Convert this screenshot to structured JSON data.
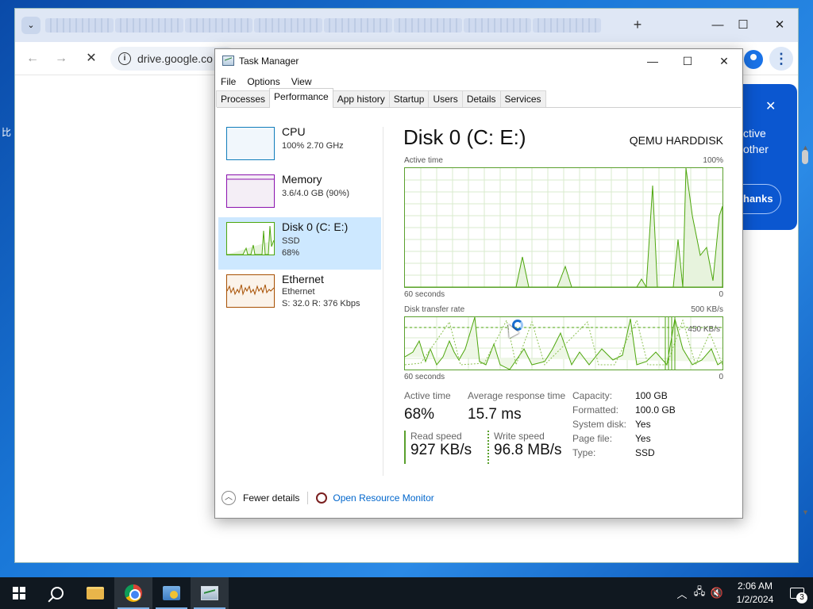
{
  "desktop": {
    "left_glyph": "比"
  },
  "chrome": {
    "url": "drive.google.co",
    "promo": {
      "text_line1": "ctive",
      "text_line2": "other",
      "button": "hanks"
    }
  },
  "task_manager": {
    "title": "Task Manager",
    "menu": [
      "File",
      "Options",
      "View"
    ],
    "tabs": [
      "Processes",
      "Performance",
      "App history",
      "Startup",
      "Users",
      "Details",
      "Services"
    ],
    "active_tab": "Performance",
    "resources": [
      {
        "name": "CPU",
        "line1": "100% 2.70 GHz",
        "line2": "",
        "color": "#117dbb"
      },
      {
        "name": "Memory",
        "line1": "3.6/4.0 GB (90%)",
        "line2": "",
        "color": "#8b12ae"
      },
      {
        "name": "Disk 0 (C: E:)",
        "line1": "SSD",
        "line2": "68%",
        "color": "#4da60c",
        "selected": true
      },
      {
        "name": "Ethernet",
        "line1": "Ethernet",
        "line2": "S: 32.0  R: 376 Kbps",
        "color": "#a74f01"
      }
    ],
    "disk": {
      "title": "Disk 0 (C: E:)",
      "model": "QEMU HARDDISK",
      "active_graph": {
        "label": "Active time",
        "max": "100%",
        "time": "60 seconds",
        "min": "0"
      },
      "transfer_graph": {
        "label": "Disk transfer rate",
        "max": "500 KB/s",
        "time": "60 seconds",
        "min": "0",
        "marker": "450 KB/s"
      },
      "stats": {
        "active_time_label": "Active time",
        "active_time": "68%",
        "avg_response_label": "Average response time",
        "avg_response": "15.7 ms",
        "read_label": "Read speed",
        "read": "927 KB/s",
        "write_label": "Write speed",
        "write": "96.8 MB/s"
      },
      "properties": [
        {
          "key": "Capacity:",
          "value": "100 GB"
        },
        {
          "key": "Formatted:",
          "value": "100.0 GB"
        },
        {
          "key": "System disk:",
          "value": "Yes"
        },
        {
          "key": "Page file:",
          "value": "Yes"
        },
        {
          "key": "Type:",
          "value": "SSD"
        }
      ]
    },
    "footer": {
      "fewer_details": "Fewer details",
      "resource_monitor": "Open Resource Monitor"
    }
  },
  "taskbar": {
    "time": "2:06 AM",
    "date": "1/2/2024",
    "notification_count": "3"
  }
}
